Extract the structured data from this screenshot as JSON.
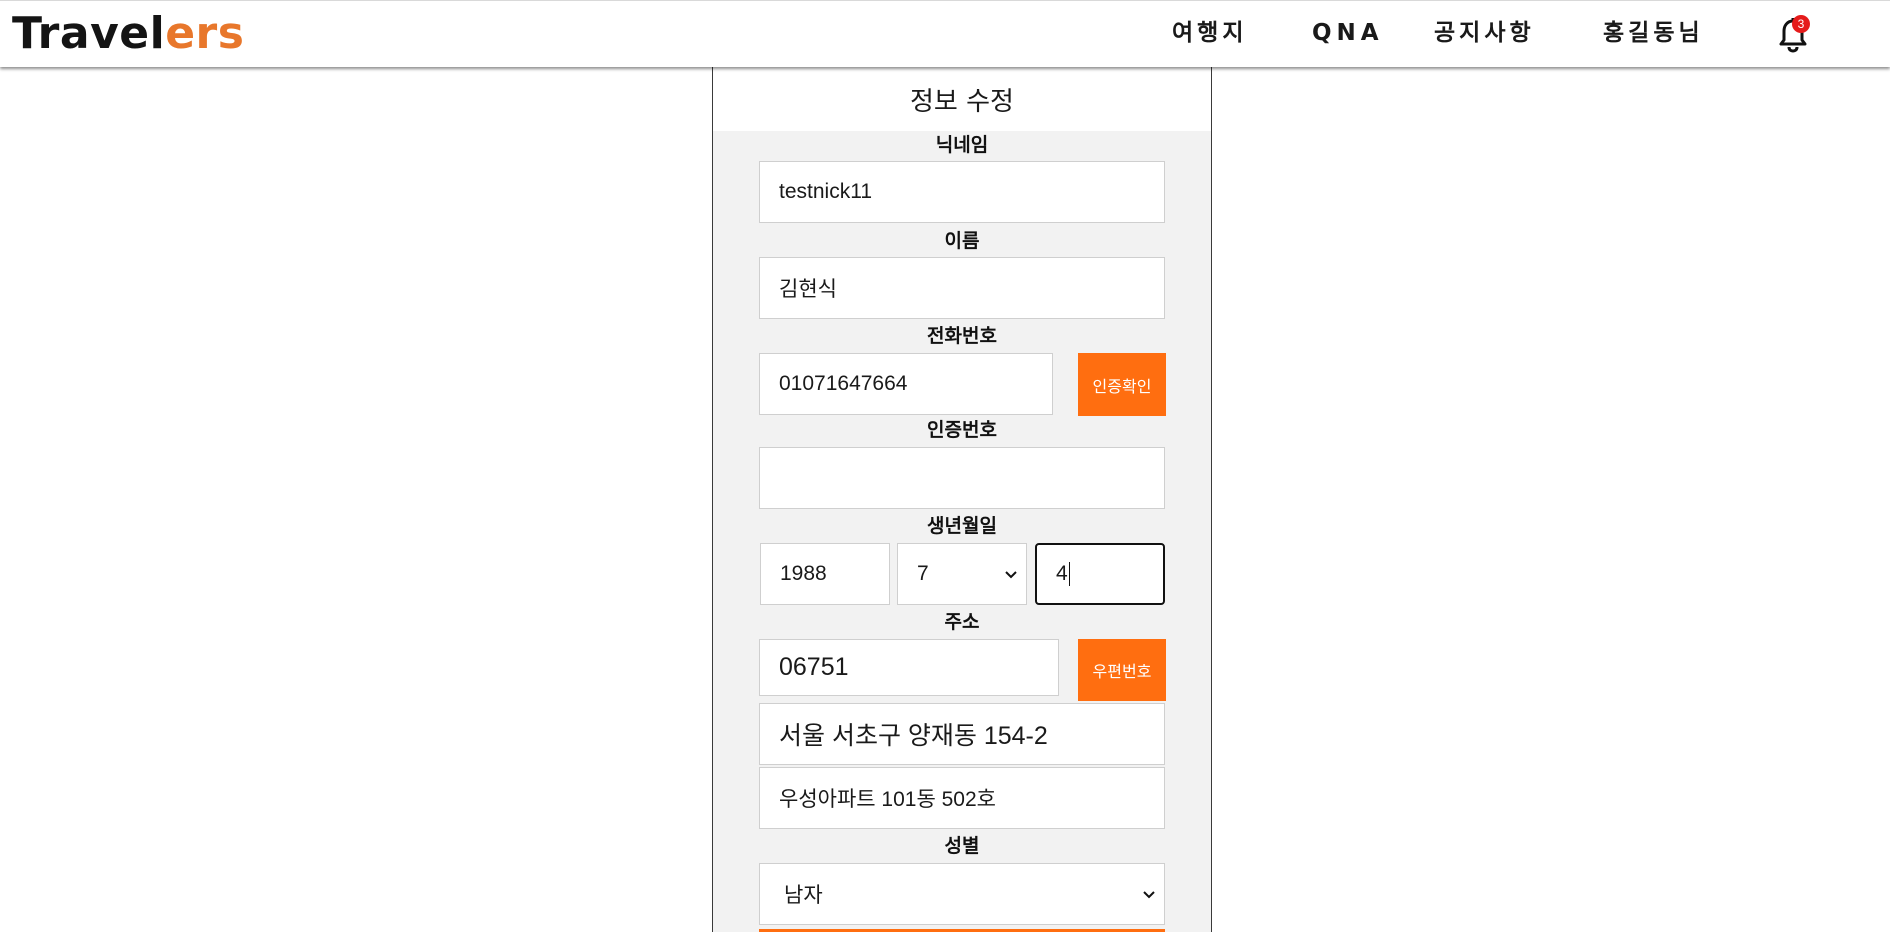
{
  "header": {
    "logo_part1": "Travel",
    "logo_part2": "ers",
    "nav": {
      "destinations": "여행지",
      "qna": "QNA",
      "notices": "공지사항",
      "user": "홍길동님"
    },
    "notification_count": "3",
    "bell_icon": "bell-icon"
  },
  "form": {
    "title": "정보 수정",
    "nickname": {
      "label": "닉네임",
      "value": "testnick11"
    },
    "name": {
      "label": "이름",
      "value": "김현식"
    },
    "phone": {
      "label": "전화번호",
      "value": "01071647664",
      "button": "인증확인"
    },
    "verify": {
      "label": "인증번호",
      "value": ""
    },
    "birth": {
      "label": "생년월일",
      "year": "1988",
      "month": "7",
      "day": "4"
    },
    "address": {
      "label": "주소",
      "postcode": "06751",
      "button": "우편번호",
      "line1": "서울 서초구 양재동 154-2",
      "line2": "우성아파트 101동 502호"
    },
    "gender": {
      "label": "성별",
      "value": "남자"
    }
  },
  "colors": {
    "accent": "#ff6e10",
    "logo_accent": "#e8772b",
    "badge": "#e51b1b",
    "form_bg": "#f2f2f2"
  }
}
